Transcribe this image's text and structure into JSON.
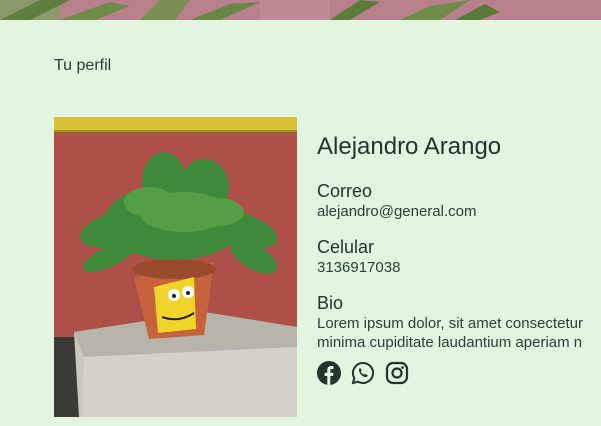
{
  "page": {
    "heading": "Tu perfil"
  },
  "profile": {
    "name": "Alejandro Arango",
    "email_label": "Correo",
    "email": "alejandro@general.com",
    "phone_label": "Celular",
    "phone": "3136917038",
    "bio_label": "Bio",
    "bio_line1": "Lorem ipsum dolor, sit amet consectetur",
    "bio_line2": "minima cupiditate laudantium aperiam n"
  },
  "social": {
    "icons": [
      "facebook-icon",
      "whatsapp-icon",
      "instagram-icon"
    ]
  },
  "colors": {
    "background": "#e3f5e0",
    "text": "#24332b"
  }
}
